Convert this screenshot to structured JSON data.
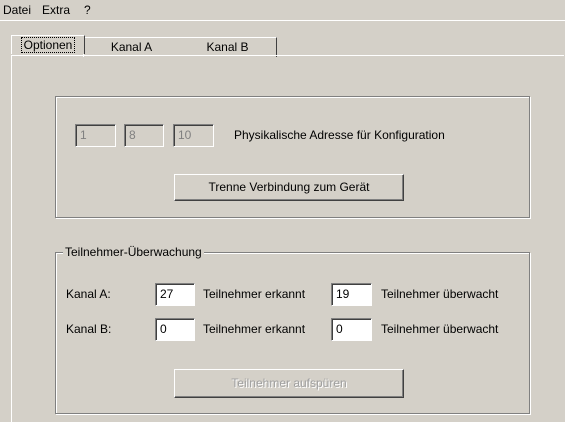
{
  "menu": {
    "items": [
      "Datei",
      "Extra",
      "?"
    ]
  },
  "tabs": [
    "Optionen",
    "Kanal A",
    "Kanal B"
  ],
  "address": {
    "parts": [
      "1",
      "8",
      "10"
    ],
    "label": "Physikalische Adresse für Konfiguration",
    "disconnect_button": "Trenne Verbindung zum Gerät"
  },
  "monitoring": {
    "title": "Teilnehmer-Überwachung",
    "rows": [
      {
        "label": "Kanal A:",
        "detected": "27",
        "detected_label": "Teilnehmer erkannt",
        "monitored": "19",
        "monitored_label": "Teilnehmer überwacht"
      },
      {
        "label": "Kanal B:",
        "detected": "0",
        "detected_label": "Teilnehmer erkannt",
        "monitored": "0",
        "monitored_label": "Teilnehmer überwacht"
      }
    ],
    "find_button": "Teilnehmer aufspüren"
  }
}
